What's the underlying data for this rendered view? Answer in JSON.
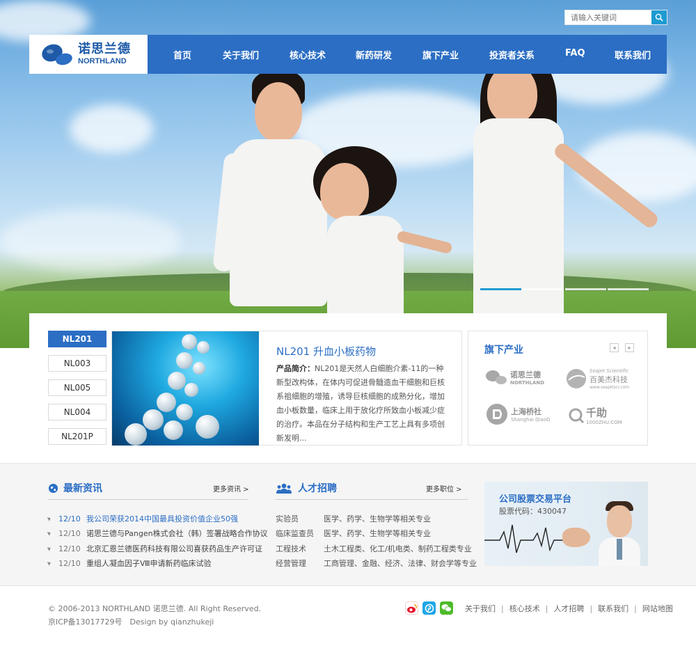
{
  "search": {
    "placeholder": "请输入关键词"
  },
  "logo": {
    "cn": "诺思兰德",
    "en": "NORTHLAND"
  },
  "nav": {
    "items": [
      "首页",
      "关于我们",
      "核心技术",
      "新药研发",
      "旗下产业",
      "投资者关系",
      "FAQ",
      "联系我们"
    ]
  },
  "products": {
    "tabs": [
      "NL201",
      "NL003",
      "NL005",
      "NL004",
      "NL201P"
    ],
    "active_tab": "NL201",
    "feature": {
      "title": "NL201 升血小板药物",
      "desc_label": "产品简介：",
      "desc": "NL201是天然人白细胞介素-11的一种新型改构体，在体内可促进骨髓造血干细胞和巨核系祖细胞的增殖，诱导巨核细胞的成熟分化，增加血小板数量，临床上用于放化疗所致血小板减少症的治疗。本品在分子结构和生产工艺上具有多项创新发明..."
    }
  },
  "brands": {
    "title": "旗下产业",
    "items": [
      {
        "cn": "诺思兰德",
        "en": "NORTHLAND"
      },
      {
        "cn": "百美杰科技",
        "en": "Seajet Scientific",
        "sub": "www.seajetsci.com"
      },
      {
        "cn": "上海桥社",
        "en": "Shanghai QiaoD"
      },
      {
        "cn": "千助",
        "en": "1000ZHU.COM"
      }
    ]
  },
  "news": {
    "title": "最新资讯",
    "more": "更多资讯 >",
    "items": [
      {
        "date": "12/10",
        "text": "我公司荣获2014中国最具投资价值企业50强",
        "highlight": true
      },
      {
        "date": "12/10",
        "text": "诺思兰德与Pangen株式会社（韩）签署战略合作协议",
        "highlight": false
      },
      {
        "date": "12/10",
        "text": "北京汇恩兰德医药科技有限公司喜获药品生产许可证",
        "highlight": false
      },
      {
        "date": "12/10",
        "text": "重组人凝血因子Ⅷ申请新药临床试验",
        "highlight": false
      }
    ]
  },
  "jobs": {
    "title": "人才招聘",
    "more": "更多职位 >",
    "items": [
      {
        "role": "实验员",
        "req": "医学、药学、生物学等相关专业"
      },
      {
        "role": "临床监查员",
        "req": "医学、药学、生物学等相关专业"
      },
      {
        "role": "工程技术",
        "req": "土木工程类、化工/机电类、制药工程类专业"
      },
      {
        "role": "经营管理",
        "req": "工商管理、金融、经济、法律、财会学等专业"
      }
    ]
  },
  "stock": {
    "title": "公司股票交易平台",
    "code": "股票代码：430047"
  },
  "footer": {
    "copyright": "© 2006-2013 NORTHLAND 诺思兰德. All Right Reserved.",
    "icp": "京ICP备13017729号　Design by qianzhukeji",
    "links": [
      "关于我们",
      "核心技术",
      "人才招聘",
      "联系我们",
      "网站地图"
    ]
  },
  "colors": {
    "primary": "#2b6ec4",
    "accent": "#1d9bd1"
  },
  "slider": {
    "count": 4,
    "active_index": 0
  }
}
